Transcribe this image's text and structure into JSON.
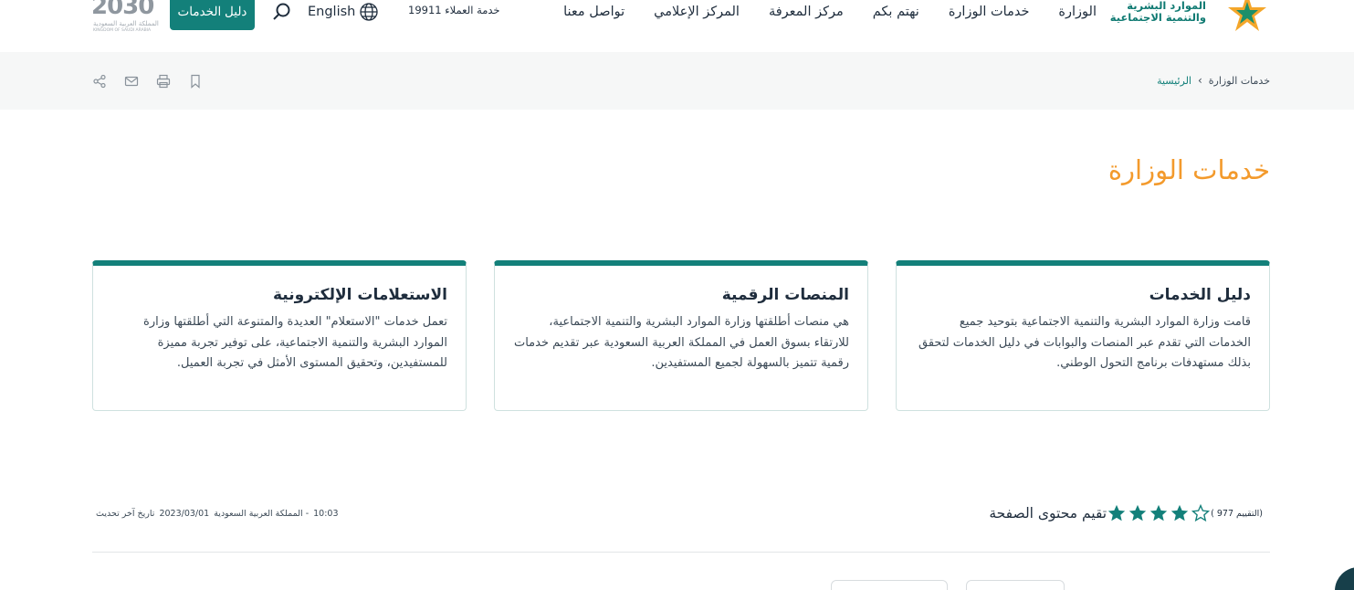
{
  "header": {
    "logo_text_line1": "الموارد البشرية",
    "logo_text_line2": "والتنمية الاجتماعية",
    "nav": [
      {
        "label": "الوزارة"
      },
      {
        "label": "خدمات الوزارة"
      },
      {
        "label": "نهتم بكم"
      },
      {
        "label": "مركز المعرفة"
      },
      {
        "label": "المركز الإعلامي"
      },
      {
        "label": "تواصل معنا"
      }
    ],
    "hotline": "خدمة العملاء 19911",
    "language": "English",
    "guide_button": "دليل الخدمات",
    "vision_number": "2030",
    "vision_ar": "المملكة العربية السعودية",
    "vision_en": "KINGDOM OF SAUDI ARABIA"
  },
  "breadcrumb": {
    "home": "الرئيسية",
    "current": "خدمات الوزارة"
  },
  "page_title": "خدمات الوزارة",
  "cards": [
    {
      "title": "دليل الخدمات",
      "text": "قامت وزارة الموارد البشرية والتنمية الاجتماعية بتوحيد جميع الخدمات التي تقدم عبر المنصات والبوابات في دليل الخدمات لتحقق بذلك مستهدفات برنامج التحول الوطني."
    },
    {
      "title": "المنصات الرقمية",
      "text": "هي منصات أطلقتها وزارة الموارد البشرية والتنمية الاجتماعية، للارتقاء بسوق العمل في المملكة العربية السعودية عبر تقديم خدمات رقمية تتميز بالسهولة لجميع المستفيدين."
    },
    {
      "title": "الاستعلامات الإلكترونية",
      "text": "تعمل خدمات \"الاستعلام\" العديدة والمتنوعة التي أطلقتها وزارة الموارد البشرية والتنمية الاجتماعية، على توفير تجربة مميزة للمستفيدين، وتحقيق المستوى الأمثل في تجربة العميل."
    }
  ],
  "rating": {
    "label": "تقيم محتوى الصفحة",
    "filled_stars": 4,
    "total_stars": 5,
    "count_text": "(التقييم 977 )"
  },
  "last_update": {
    "label": "تاريخ آخر تحديث",
    "date": "2023/03/01",
    "location": "- المملكة العربية السعودية",
    "time": "10:03"
  },
  "colors": {
    "primary": "#13807a",
    "accent": "#f39a2c",
    "text": "#1f2d3d",
    "band": "#f6f7f7"
  }
}
